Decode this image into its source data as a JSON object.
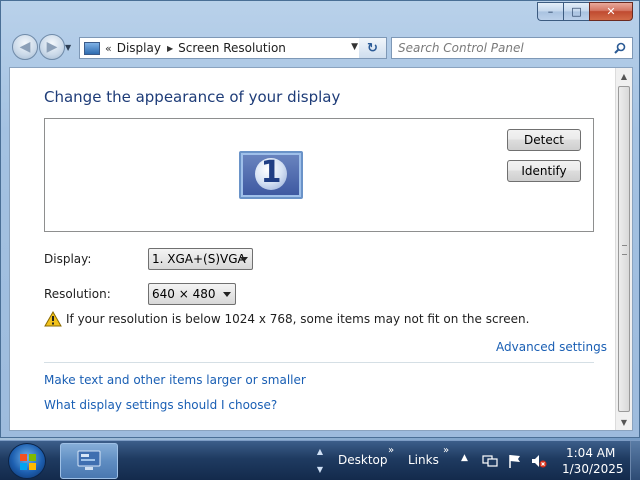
{
  "window": {
    "caption": {
      "minimize": "–",
      "maximize": "□",
      "close": "✕"
    }
  },
  "navbar": {
    "back_glyph": "◀",
    "forward_glyph": "▶",
    "breadcrumb_sep": "«",
    "breadcrumbs": [
      "Display",
      "Screen Resolution"
    ],
    "crumb_arrow": "▶",
    "refresh_glyph": "↻",
    "search_placeholder": "Search Control Panel"
  },
  "main": {
    "title": "Change the appearance of your display",
    "monitor_number": "1",
    "detect_label": "Detect",
    "identify_label": "Identify",
    "display_label": "Display:",
    "display_value": "1. XGA+(S)VGA",
    "resolution_label": "Resolution:",
    "resolution_value": "640 × 480",
    "warning_text": "If your resolution is below 1024 x 768, some items may not fit on the screen.",
    "advanced_link": "Advanced settings",
    "links": [
      "Make text and other items larger or smaller",
      "What display settings should I choose?"
    ]
  },
  "taskbar": {
    "toolbars": [
      "Desktop",
      "Links"
    ],
    "chevron": "»",
    "tray_expand": "▲",
    "time": "1:04 AM",
    "date": "1/30/2025"
  },
  "icons": {
    "address": "control-panel-icon",
    "search": "search-icon",
    "warning": "warning-icon",
    "start": "windows-start-icon",
    "task": "control-panel-task-icon",
    "network": "network-icon",
    "flag": "action-center-flag-icon",
    "volume": "volume-muted-icon"
  }
}
